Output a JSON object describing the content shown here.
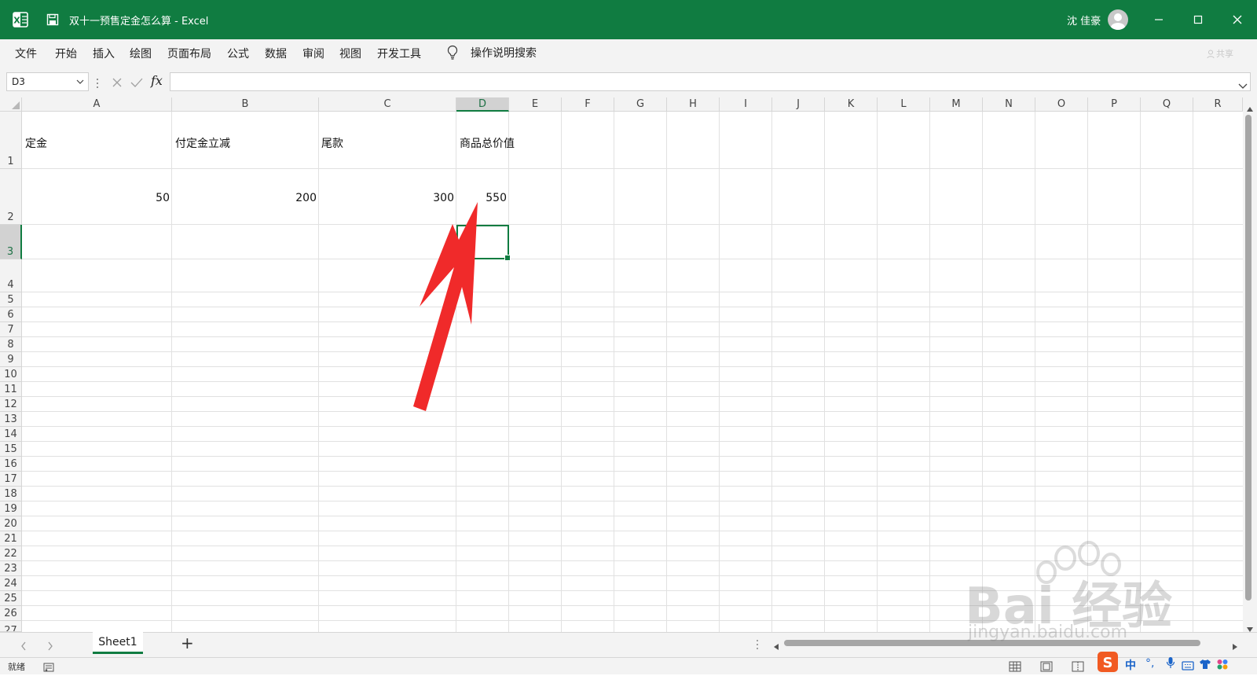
{
  "titlebar": {
    "document_title": "双十一预售定金怎么算  -  Excel",
    "user_name": "沈 佳豪"
  },
  "menu": {
    "items": [
      "文件",
      "开始",
      "插入",
      "绘图",
      "页面布局",
      "公式",
      "数据",
      "审阅",
      "视图",
      "开发工具"
    ],
    "search_label": "操作说明搜索",
    "share_label": "共享"
  },
  "formula_bar": {
    "name_box": "D3",
    "fx_label": "fx",
    "formula": ""
  },
  "sheet": {
    "columns": [
      "A",
      "B",
      "C",
      "D",
      "E",
      "F",
      "G",
      "H",
      "I",
      "J",
      "K",
      "L",
      "M",
      "N",
      "O",
      "P",
      "Q",
      "R"
    ],
    "rows": [
      "1",
      "2",
      "3",
      "4",
      "5",
      "6",
      "7",
      "8",
      "9",
      "10",
      "11",
      "12",
      "13",
      "14",
      "15",
      "16",
      "17",
      "18",
      "19",
      "20",
      "21",
      "22",
      "23",
      "24",
      "25",
      "26",
      "27"
    ],
    "selected_cell": "D3",
    "cells": {
      "A1": "定金",
      "B1": "付定金立减",
      "C1": "尾款",
      "D1": "商品总价值",
      "A2": "50",
      "B2": "200",
      "C2": "300",
      "D2": "550"
    }
  },
  "tabs": {
    "sheet1": "Sheet1",
    "add": "+"
  },
  "status": {
    "ready": "就绪"
  },
  "watermark": {
    "brand": "Bai 经验",
    "url": "jingyan.baidu.com"
  },
  "colors": {
    "excel_green": "#107c41",
    "arrow_red": "#f02a2a"
  }
}
